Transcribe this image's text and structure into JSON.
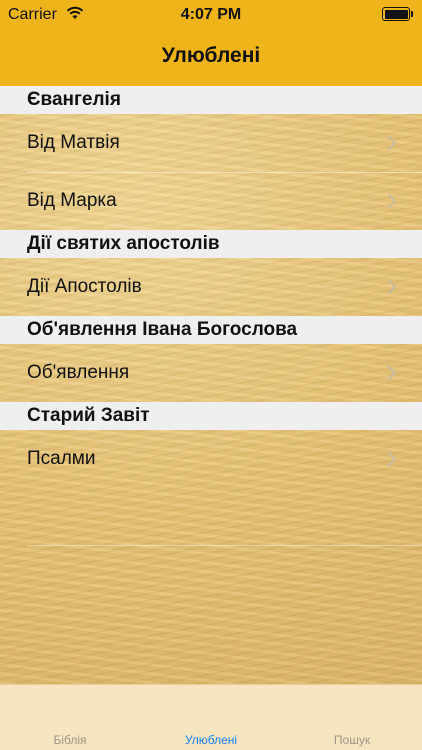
{
  "status_bar": {
    "carrier": "Carrier",
    "time": "4:07 PM",
    "battery_level": 1.0
  },
  "nav": {
    "title": "Улюблені",
    "background": "#efb419"
  },
  "sections": [
    {
      "header": "Євангелія",
      "rows": [
        "Від Матвія",
        "Від Марка"
      ]
    },
    {
      "header": "Дії святих апостолів",
      "rows": [
        "Дії Апостолів"
      ]
    },
    {
      "header": "Об'явлення Івана Богослова",
      "rows": [
        "Об'явлення"
      ]
    },
    {
      "header": "Старий Завіт",
      "rows": [
        "Псалми"
      ]
    }
  ],
  "tabbar": {
    "tabs": [
      {
        "label": "Біблія",
        "active": false
      },
      {
        "label": "Улюблені",
        "active": true
      },
      {
        "label": "Пошук",
        "active": false
      }
    ],
    "active_color": "#1a7cf2"
  }
}
